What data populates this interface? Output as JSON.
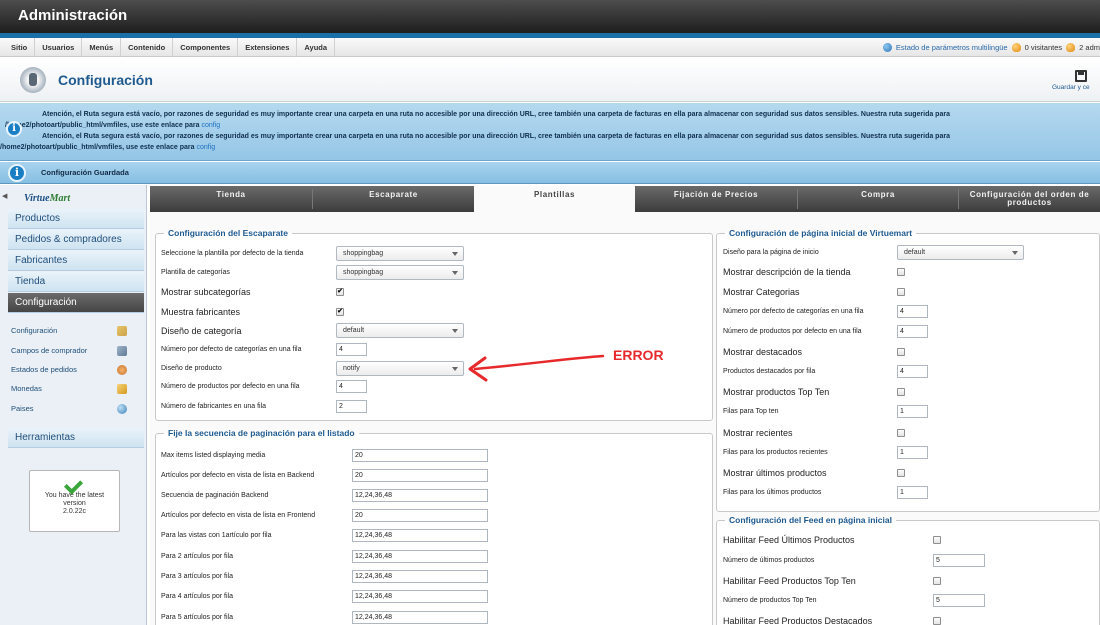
{
  "app": {
    "title": "Administración"
  },
  "menubar": {
    "items": [
      "Sitio",
      "Usuarios",
      "Menús",
      "Contenido",
      "Componentes",
      "Extensiones",
      "Ayuda"
    ],
    "status": {
      "multilang": "Estado de parámetros multilingüe",
      "visitors": "0 visitantes",
      "admins": "2 adm"
    }
  },
  "titlebar": {
    "title": "Configuración",
    "save_label": "Guardar y ce"
  },
  "warning": {
    "line1": "Atención, el Ruta segura está vacío, por razones de seguridad es muy importante crear una carpeta en una ruta no accesible por una dirección URL, cree también una carpeta de facturas en ella para almacenar con seguridad sus datos sensibles. Nuestra ruta sugerida para",
    "line2": "/home2/photoart/public_html/vmfiles, use este enlace para",
    "link": "config"
  },
  "saved_message": "Configuración Guardada",
  "sidebar": {
    "logo": {
      "part1": "Virtue",
      "part2": "Mart"
    },
    "main_items": [
      "Productos",
      "Pedidos & compradores",
      "Fabricantes",
      "Tienda",
      "Configuración",
      "Herramientas"
    ],
    "sub_items": [
      "Configuración",
      "Campos de comprador",
      "Estados de pedidos",
      "Monedas",
      "Paises"
    ],
    "version": {
      "line1": "You have the latest",
      "line2": "version",
      "line3": "2.0.22c"
    }
  },
  "tabs": [
    "Tienda",
    "Escaparate",
    "Plantillas",
    "Fijación de Precios",
    "Compra",
    "Configuración del orden de productos"
  ],
  "storefront": {
    "legend": "Configuración del Escaparate",
    "rows": [
      {
        "label": "Seleccione la plantilla por defecto de la tienda",
        "value": "shoppingbag"
      },
      {
        "label": "Plantilla de categorías",
        "value": "shoppingbag"
      },
      {
        "label": "Mostrar subcategorías",
        "value": "✔"
      },
      {
        "label": "Muestra fabricantes",
        "value": "✔"
      },
      {
        "label": "Diseño de categoría",
        "value": "default"
      },
      {
        "label": "Número por defecto de categorías en una fila",
        "value": "4"
      },
      {
        "label": "Diseño de producto",
        "value": "notify"
      },
      {
        "label": "Número de productos por defecto en una fila",
        "value": "4"
      },
      {
        "label": "Número de fabricantes en una fila",
        "value": "2"
      }
    ]
  },
  "pagination": {
    "legend": "Fije la secuencia de paginación para el listado",
    "rows": [
      {
        "label": "Max items listed displaying media",
        "value": "20"
      },
      {
        "label": "Artículos por defecto en vista de lista en Backend",
        "value": "20"
      },
      {
        "label": "Secuencia de paginación Backend",
        "value": "12,24,36,48"
      },
      {
        "label": "Artículos por defecto en vista de lista en Frontend",
        "value": "20"
      },
      {
        "label": "Para las vistas con 1artículo por fila",
        "value": "12,24,36,48"
      },
      {
        "label": "Para 2 artículos por fila",
        "value": "12,24,36,48"
      },
      {
        "label": "Para 3 artículos por fila",
        "value": "12,24,36,48"
      },
      {
        "label": "Para 4 artículos por fila",
        "value": "12,24,36,48"
      },
      {
        "label": "Para 5 artículos por fila",
        "value": "12,24,36,48"
      }
    ]
  },
  "homepage": {
    "legend": "Configuración de página inicial de Virtuemart",
    "rows": [
      {
        "label": "Diseño para la página de inicio",
        "value": "default"
      },
      {
        "label": "Mostrar descripción de la tienda",
        "value": ""
      },
      {
        "label": "Mostrar Categorias",
        "value": ""
      },
      {
        "label": "Número por defecto de categorías en una fila",
        "value": "4"
      },
      {
        "label": "Número de productos por defecto en una fila",
        "value": "4"
      },
      {
        "label": "Mostrar destacados",
        "value": ""
      },
      {
        "label": "Productos destacados por fila",
        "value": "4"
      },
      {
        "label": "Mostrar productos Top Ten",
        "value": ""
      },
      {
        "label": "Filas para Top ten",
        "value": "1"
      },
      {
        "label": "Mostrar recientes",
        "value": ""
      },
      {
        "label": "Filas para los productos recientes",
        "value": "1"
      },
      {
        "label": "Mostrar últimos productos",
        "value": ""
      },
      {
        "label": "Filas para los últimos productos",
        "value": "1"
      }
    ]
  },
  "feed": {
    "legend": "Configuración del Feed en página inicial",
    "rows": [
      {
        "label": "Habilitar Feed Últimos Productos",
        "value": ""
      },
      {
        "label": "Número de últimos productos",
        "value": "5"
      },
      {
        "label": "Habilitar Feed Productos Top Ten",
        "value": ""
      },
      {
        "label": "Número de productos Top Ten",
        "value": "5"
      },
      {
        "label": "Habilitar Feed Productos Destacados",
        "value": ""
      }
    ]
  },
  "annotation": {
    "text": "ERROR",
    "color": "#e8292c"
  }
}
